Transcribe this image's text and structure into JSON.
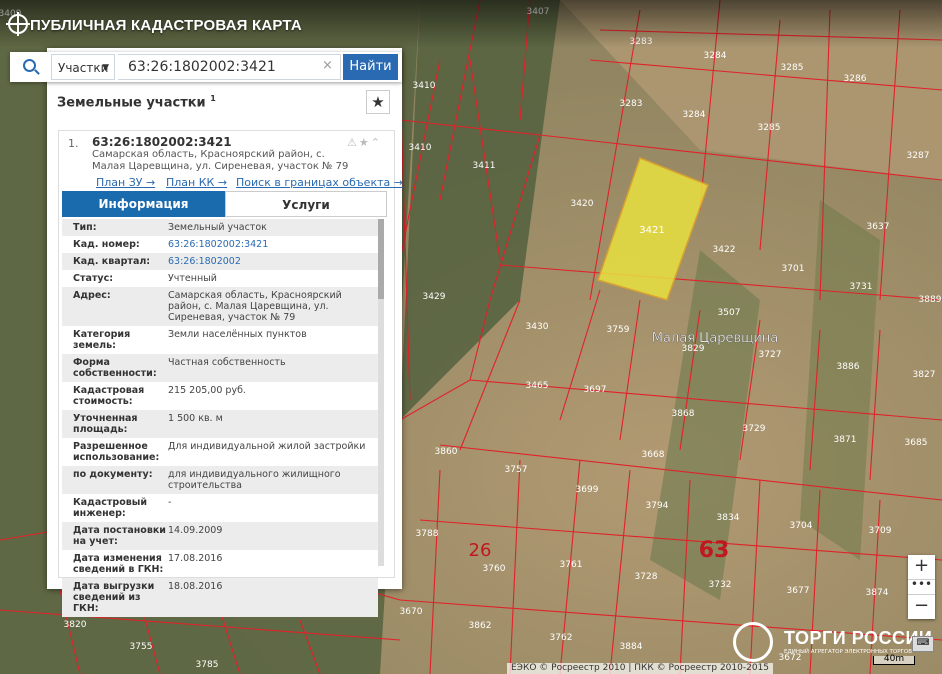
{
  "app_title": "ПУБЛИЧНАЯ КАДАСТРОВАЯ КАРТА",
  "search": {
    "type_selector": "Участки",
    "query": "63:26:1802002:3421",
    "clear_glyph": "×",
    "button": "Найти"
  },
  "panel": {
    "title": "Земельные участки",
    "title_superscript": "1",
    "favorite_icon": "star-icon"
  },
  "result": {
    "index": "1.",
    "cadastral_number": "63:26:1802002:3421",
    "address": "Самарская область, Красноярский район, с. Малая Царевщина, ул. Сиреневая, участок № 79",
    "links": {
      "plan_zu": "План ЗУ →",
      "plan_kk": "План КК →",
      "search_bounds": "Поиск в границах объекта →"
    }
  },
  "tabs": {
    "info": "Информация",
    "services": "Услуги"
  },
  "attributes": [
    {
      "label": "Тип:",
      "value": "Земельный участок",
      "link": false
    },
    {
      "label": "Кад. номер:",
      "value": "63:26:1802002:3421",
      "link": true
    },
    {
      "label": "Кад. квартал:",
      "value": "63:26:1802002",
      "link": true
    },
    {
      "label": "Статус:",
      "value": "Учтенный",
      "link": false
    },
    {
      "label": "Адрес:",
      "value": "Самарская область, Красноярский район, с. Малая Царевщина, ул. Сиреневая, участок № 79",
      "link": false
    },
    {
      "label": "Категория земель:",
      "value": "Земли населённых пунктов",
      "link": false
    },
    {
      "label": "Форма собственности:",
      "value": "Частная собственность",
      "link": false
    },
    {
      "label": "Кадастровая стоимость:",
      "value": "215 205,00 руб.",
      "link": false
    },
    {
      "label": "Уточненная площадь:",
      "value": "1 500 кв. м",
      "link": false
    },
    {
      "label": "Разрешенное использование:",
      "value": "Для индивидуальной жилой застройки",
      "link": false
    },
    {
      "label": "по документу:",
      "value": "для индивидуального жилищного строительства",
      "link": false
    },
    {
      "label": "Кадастровый инженер:",
      "value": "-",
      "link": false
    },
    {
      "label": "Дата постановки на учет:",
      "value": "14.09.2009",
      "link": false
    },
    {
      "label": "Дата изменения сведений в ГКН:",
      "value": "17.08.2016",
      "link": false
    },
    {
      "label": "Дата выгрузки сведений из ГКН:",
      "value": "18.08.2016",
      "link": false
    }
  ],
  "map": {
    "selected_parcel": "3421",
    "village_label": "Малая Царевщина",
    "district_labels": [
      "26",
      "63"
    ],
    "parcel_labels": [
      "3407",
      "3409",
      "3410",
      "3410",
      "3411",
      "3420",
      "3429",
      "3430",
      "3465",
      "3507",
      "3283",
      "3283",
      "3284",
      "3284",
      "3285",
      "3285",
      "3286",
      "3287",
      "3422",
      "3637",
      "3701",
      "3731",
      "3759",
      "3829",
      "3727",
      "3697",
      "3886",
      "3827",
      "3868",
      "3729",
      "3871",
      "3685",
      "3860",
      "3668",
      "3757",
      "3699",
      "3794",
      "3834",
      "3704",
      "3709",
      "3788",
      "3760",
      "3761",
      "3728",
      "3732",
      "3677",
      "3874",
      "3670",
      "3820",
      "3862",
      "3762",
      "3884",
      "3755",
      "3785",
      "3672",
      "3889",
      "3731"
    ],
    "copyright": "ЕЭКО © Росреестр 2010 | ПКК © Росреестр 2010-2015",
    "scale": "40m",
    "zoom_in": "+",
    "zoom_out": "−",
    "zoom_dots": "•••",
    "watermark_title": "ТОРГИ РОССИИ",
    "watermark_subtitle": "ЕДИНЫЙ АГРЕГАТОР ЭЛЕКТРОННЫХ ТОРГОВ",
    "keyboard_badge": "⌨",
    "selection_color": "#e8e040",
    "boundary_color": "#e0222a"
  }
}
